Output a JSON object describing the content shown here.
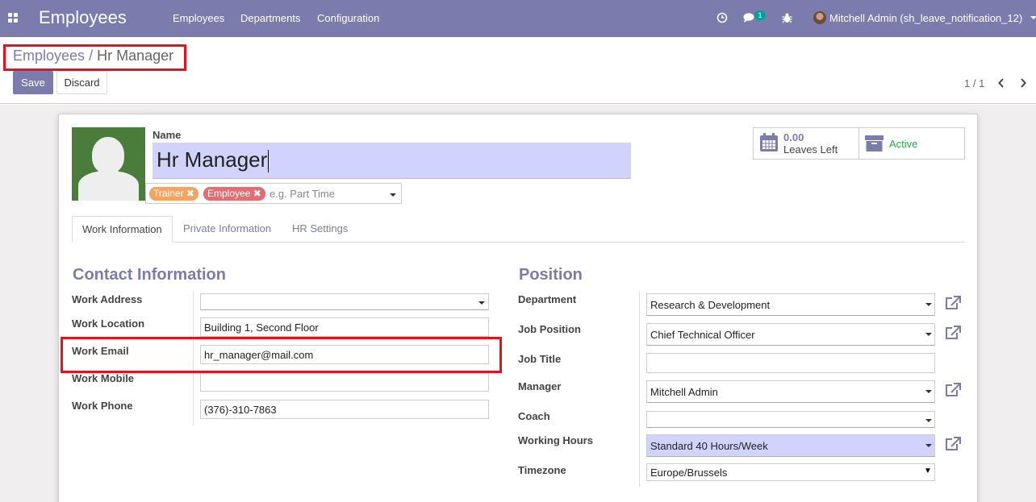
{
  "navbar": {
    "app_title": "Employees",
    "menu": [
      "Employees",
      "Departments",
      "Configuration"
    ],
    "message_count": "1",
    "user": "Mitchell Admin (sh_leave_notification_12)",
    "bg_color": "#7c7bad"
  },
  "breadcrumb": {
    "parent": "Employees",
    "separator": "/",
    "current": "Hr Manager"
  },
  "actions": {
    "save": "Save",
    "discard": "Discard"
  },
  "pager": {
    "value": "1 / 1"
  },
  "form": {
    "name_label": "Name",
    "name_value": "Hr Manager",
    "tags": [
      "Trainer",
      "Employee"
    ],
    "tags_placeholder": "e.g. Part Time",
    "smart_buttons": {
      "leaves_value": "0.00",
      "leaves_label": "Leaves Left",
      "active_label": "Active"
    },
    "tabs": [
      "Work Information",
      "Private Information",
      "HR Settings"
    ],
    "contact": {
      "title": "Contact Information",
      "fields": [
        {
          "label": "Work Address",
          "value": ""
        },
        {
          "label": "Work Location",
          "value": "Building 1, Second Floor"
        },
        {
          "label": "Work Email",
          "value": "hr_manager@mail.com"
        },
        {
          "label": "Work Mobile",
          "value": ""
        },
        {
          "label": "Work Phone",
          "value": "(376)-310-7863"
        }
      ]
    },
    "position": {
      "title": "Position",
      "fields": [
        {
          "label": "Department",
          "value": "Research & Development"
        },
        {
          "label": "Job Position",
          "value": "Chief Technical Officer"
        },
        {
          "label": "Job Title",
          "value": ""
        },
        {
          "label": "Manager",
          "value": "Mitchell Admin"
        },
        {
          "label": "Coach",
          "value": ""
        },
        {
          "label": "Working Hours",
          "value": "Standard 40 Hours/Week"
        },
        {
          "label": "Timezone",
          "value": "Europe/Brussels"
        }
      ]
    }
  },
  "icons": [
    "apps-icon",
    "clock-icon",
    "chat-icon",
    "bug-icon",
    "chevron-left-icon",
    "chevron-right-icon",
    "calendar-icon",
    "archive-icon",
    "external-link-icon"
  ]
}
